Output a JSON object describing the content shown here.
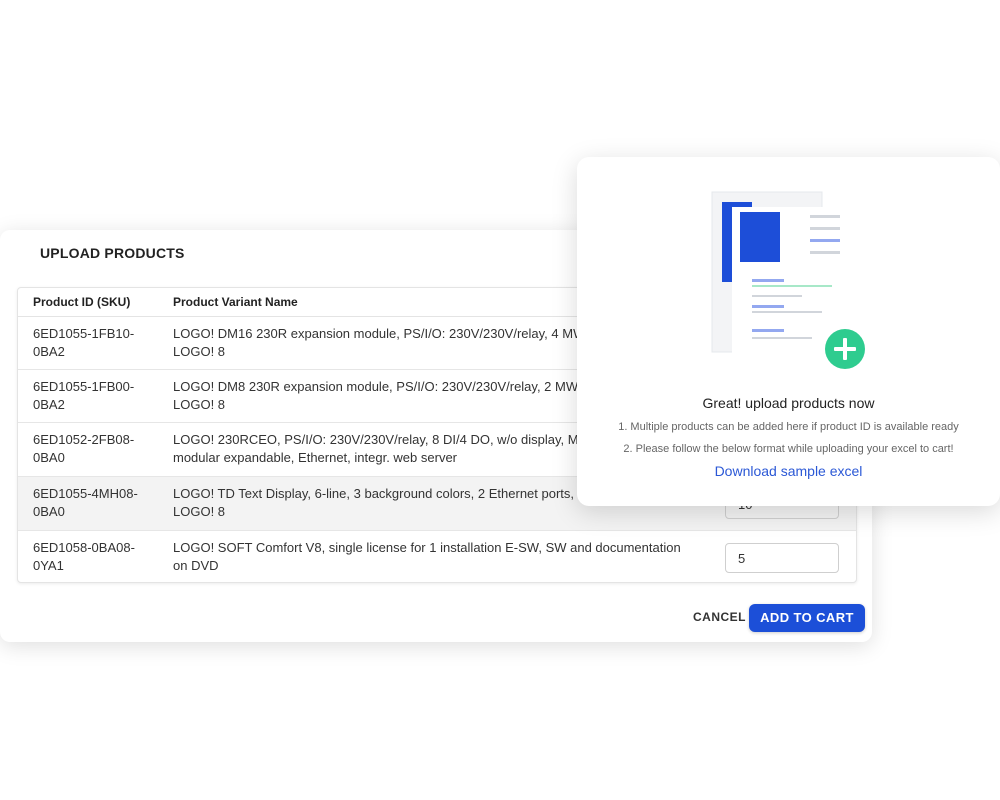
{
  "dialog": {
    "title": "UPLOAD PRODUCTS",
    "columns": {
      "sku": "Product ID (SKU)",
      "name": "Product Variant Name"
    },
    "rows": [
      {
        "sku": "6ED1055-1FB10-0BA2",
        "name": "LOGO! DM16 230R expansion module, PS/I/O: 230V/230V/relay, 4 MW, 16 DI/8 DO, for LOGO! 8",
        "qty": ""
      },
      {
        "sku": "6ED1055-1FB00-0BA2",
        "name": "LOGO! DM8 230R expansion module, PS/I/O: 230V/230V/relay, 2 MW, 4 DI/4 DO, for LOGO! 8",
        "qty": ""
      },
      {
        "sku": "6ED1052-2FB08-0BA0",
        "name": "LOGO! 230RCEO, PS/I/O: 230V/230V/relay, 8 DI/4 DO, w/o display, Memory 400 blocks, modular expandable, Ethernet, integr. web server",
        "qty": ""
      },
      {
        "sku": "6ED1055-4MH08-0BA0",
        "name": "LOGO! TD Text Display, 6-line, 3 background colors, 2 Ethernet ports, incl. accessories for LOGO! 8",
        "qty": "10"
      },
      {
        "sku": "6ED1058-0BA08-0YA1",
        "name": "LOGO! SOFT Comfort V8, single license for 1 installation E-SW, SW and documentation on DVD",
        "qty": "5"
      }
    ],
    "cancel_label": "CANCEL",
    "add_label": "ADD TO CART",
    "accent_color": "#1c4fd8"
  },
  "upload": {
    "title": "Great! upload products now",
    "line1": "1. Multiple products can be added here if product ID is available ready",
    "line2": "2. Please follow the below format while uploading your excel to cart!",
    "link": "Download sample excel",
    "illustration_icon": "documents-add-icon",
    "plus_color": "#2ecc8f"
  }
}
